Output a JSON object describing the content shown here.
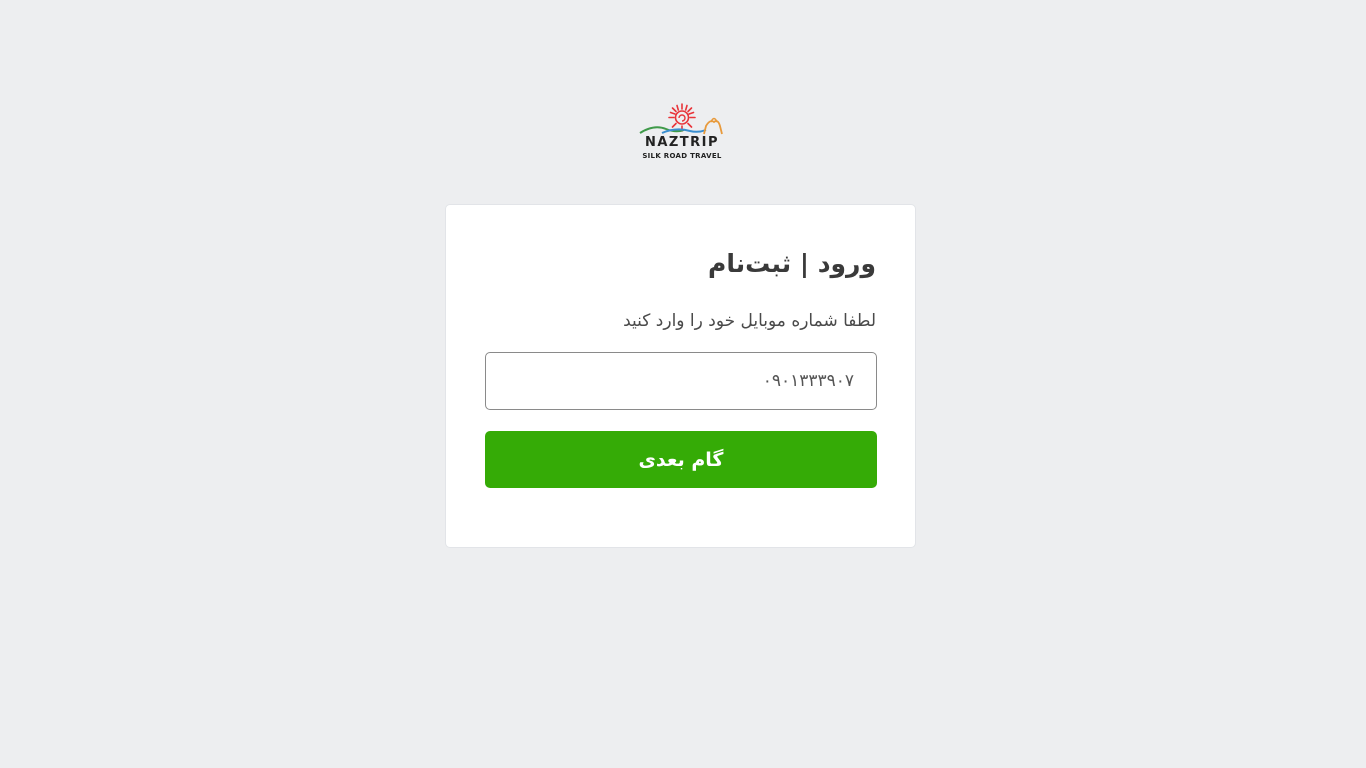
{
  "logo": {
    "wordmark": "NAZTRIP",
    "tagline": "SILK ROAD TRAVEL"
  },
  "login_card": {
    "title": "ورود | ثبت‌نام",
    "subtitle": "لطفا شماره موبایل خود را وارد کنید",
    "phone_value": "۰۹۰۱۳۳۳۹۰۷",
    "next_button_label": "گام بعدی"
  },
  "colors": {
    "page_background": "#edeef0",
    "card_background": "#ffffff",
    "button_green": "#35ab06",
    "logo_sun": "#e8343a",
    "logo_hill_green": "#3f9a4a",
    "logo_hill_blue": "#3b8fd0",
    "logo_dome_orange": "#e89a3c"
  },
  "icons": {
    "logo_sun": "sun-icon",
    "logo_landscape": "landscape-icon"
  }
}
